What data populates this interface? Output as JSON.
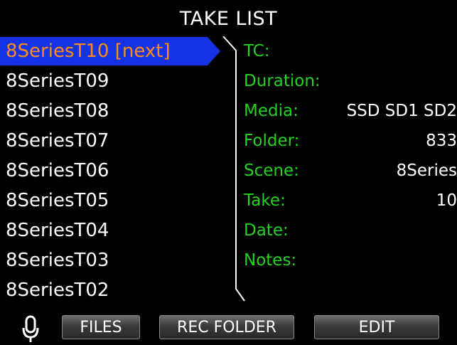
{
  "header": {
    "title": "TAKE LIST"
  },
  "takes": [
    {
      "label": "8SeriesT10 [next]",
      "selected": true
    },
    {
      "label": "8SeriesT09"
    },
    {
      "label": "8SeriesT08"
    },
    {
      "label": "8SeriesT07"
    },
    {
      "label": "8SeriesT06"
    },
    {
      "label": "8SeriesT05"
    },
    {
      "label": "8SeriesT04"
    },
    {
      "label": "8SeriesT03"
    },
    {
      "label": "8SeriesT02"
    }
  ],
  "details": {
    "tc": {
      "label": "TC:",
      "value": ""
    },
    "duration": {
      "label": "Duration:",
      "value": ""
    },
    "media": {
      "label": "Media:",
      "value": "SSD SD1 SD2"
    },
    "folder": {
      "label": "Folder:",
      "value": "833"
    },
    "scene": {
      "label": "Scene:",
      "value": "8Series"
    },
    "take": {
      "label": "Take:",
      "value": "10"
    },
    "date": {
      "label": "Date:",
      "value": ""
    },
    "notes": {
      "label": "Notes:",
      "value": ""
    }
  },
  "toolbar": {
    "mic_icon": "microphone-icon",
    "files_label": "FILES",
    "rec_folder_label": "REC FOLDER",
    "edit_label": "EDIT"
  },
  "colors": {
    "selection": "#1433e6",
    "selected_text": "#ff8c1a",
    "label_green": "#22d322",
    "background": "#000000"
  }
}
